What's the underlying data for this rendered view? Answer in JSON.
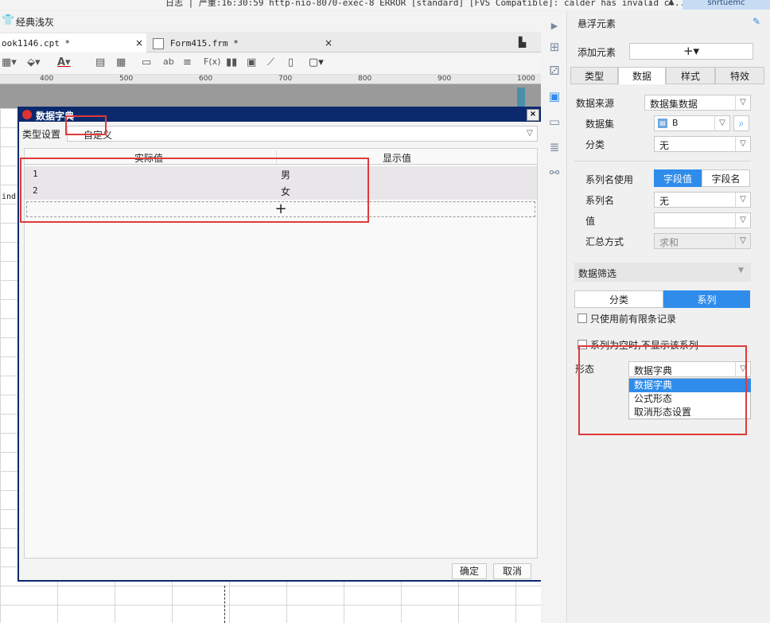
{
  "logbar": {
    "text": "日志 | 严重:16:30:59 http-nio-8070-exec-8 ERROR [standard] [FVS Compatible]: calder has invalid c...",
    "user": "snrtuemc"
  },
  "theme": {
    "label": "经典浅灰"
  },
  "tabs": [
    {
      "label": "ook1146.cpt *",
      "close": "×"
    },
    {
      "label": "Form415.frm *",
      "close": "×"
    }
  ],
  "ruler": {
    "ticks": [
      "400",
      "500",
      "600",
      "700",
      "800",
      "900",
      "1000"
    ]
  },
  "sheet": {
    "cell_text": "ind"
  },
  "dialog": {
    "title": "数据字典",
    "close": "×",
    "type_label": "类型设置",
    "type_value": "自定义",
    "columns": [
      "实际值",
      "显示值"
    ],
    "rows": [
      {
        "actual": "1",
        "display": "男"
      },
      {
        "actual": "2",
        "display": "女"
      }
    ],
    "add_symbol": "+",
    "ok_label": "确定",
    "cancel_label": "取消"
  },
  "panel": {
    "title": "悬浮元素",
    "add_element_label": "添加元素",
    "add_symbol": "+▾",
    "tabs": [
      "类型",
      "数据",
      "样式",
      "特效"
    ],
    "active_tab": "数据",
    "data_source_label": "数据来源",
    "data_source_value": "数据集数据",
    "dataset_label": "数据集",
    "dataset_value": "B",
    "category_label": "分类",
    "category_value": "无",
    "series_name_use_label": "系列名使用",
    "series_name_options": [
      "字段值",
      "字段名"
    ],
    "series_name_label": "系列名",
    "series_name_value": "无",
    "value_label": "值",
    "value_value": "",
    "summary_label": "汇总方式",
    "summary_value": "求和",
    "filter_header": "数据筛选",
    "filter_tabs": [
      "分类",
      "系列"
    ],
    "filter_active": "系列",
    "only_top_label": "只使用前有限条记录",
    "hide_empty_label": "系列为空时,不显示该系列",
    "form_label": "形态",
    "form_value": "数据字典",
    "form_options": [
      "数据字典",
      "公式形态",
      "取消形态设置"
    ]
  },
  "colors": {
    "accent": "#2f8ceb",
    "dialog_title": "#0b2a6e",
    "highlight": "#e03a3a"
  }
}
